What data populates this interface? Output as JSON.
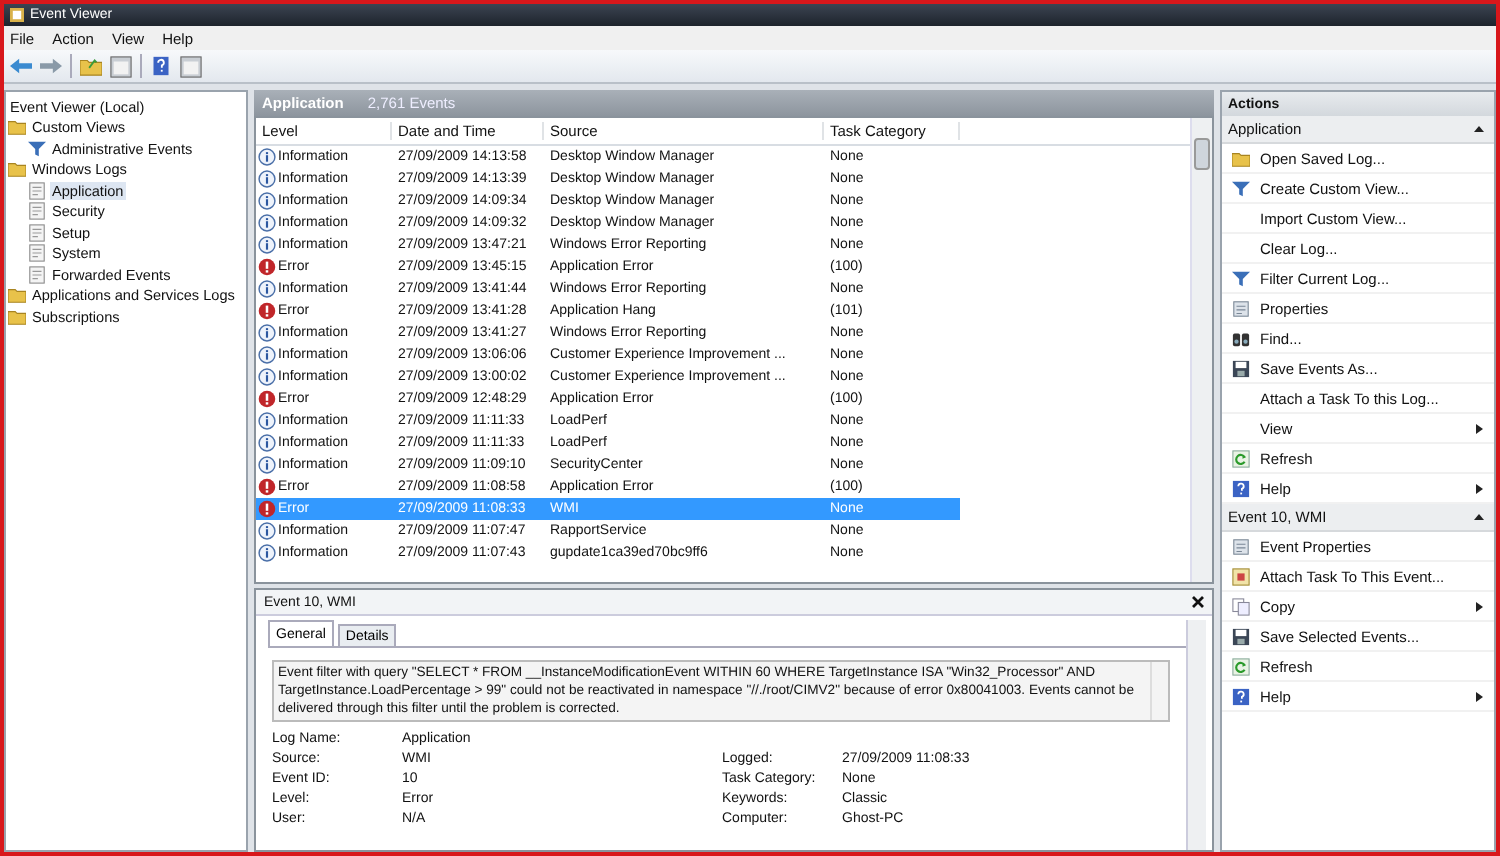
{
  "window": {
    "title": "Event Viewer"
  },
  "menu": [
    "File",
    "Action",
    "View",
    "Help"
  ],
  "toolbar": [
    {
      "kind": "back"
    },
    {
      "kind": "forward"
    },
    {
      "kind": "folder"
    },
    {
      "kind": "pane"
    },
    {
      "kind": "help"
    },
    {
      "kind": "pane"
    }
  ],
  "tree": {
    "label": "Event Viewer (Local)",
    "children": [
      {
        "label": "Custom Views",
        "kind": "folder",
        "selected": false,
        "children": [
          {
            "label": "Administrative Events",
            "kind": "filter",
            "selected": false
          }
        ]
      },
      {
        "label": "Windows Logs",
        "kind": "folder",
        "selected": false,
        "children": [
          {
            "label": "Application",
            "kind": "log",
            "selected": true
          },
          {
            "label": "Security",
            "kind": "log",
            "selected": false
          },
          {
            "label": "Setup",
            "kind": "log",
            "selected": false
          },
          {
            "label": "System",
            "kind": "log",
            "selected": false
          },
          {
            "label": "Forwarded Events",
            "kind": "log",
            "selected": false
          }
        ]
      },
      {
        "label": "Applications and Services Logs",
        "kind": "folder",
        "selected": false
      },
      {
        "label": "Subscriptions",
        "kind": "folder",
        "selected": false
      }
    ]
  },
  "log_header": {
    "name": "Application",
    "count": "2,761 Events"
  },
  "table": {
    "columns": [
      "Level",
      "Date and Time",
      "Source",
      "Task Category"
    ],
    "rows": [
      {
        "kind": "information",
        "level": "Information",
        "date": "27/09/2009 14:13:58",
        "source": "Desktop Window Manager",
        "category": "None",
        "selected": false
      },
      {
        "kind": "information",
        "level": "Information",
        "date": "27/09/2009 14:13:39",
        "source": "Desktop Window Manager",
        "category": "None",
        "selected": false
      },
      {
        "kind": "information",
        "level": "Information",
        "date": "27/09/2009 14:09:34",
        "source": "Desktop Window Manager",
        "category": "None",
        "selected": false
      },
      {
        "kind": "information",
        "level": "Information",
        "date": "27/09/2009 14:09:32",
        "source": "Desktop Window Manager",
        "category": "None",
        "selected": false
      },
      {
        "kind": "information",
        "level": "Information",
        "date": "27/09/2009 13:47:21",
        "source": "Windows Error Reporting",
        "category": "None",
        "selected": false
      },
      {
        "kind": "error",
        "level": "Error",
        "date": "27/09/2009 13:45:15",
        "source": "Application Error",
        "category": "(100)",
        "selected": false
      },
      {
        "kind": "information",
        "level": "Information",
        "date": "27/09/2009 13:41:44",
        "source": "Windows Error Reporting",
        "category": "None",
        "selected": false
      },
      {
        "kind": "error",
        "level": "Error",
        "date": "27/09/2009 13:41:28",
        "source": "Application Hang",
        "category": "(101)",
        "selected": false
      },
      {
        "kind": "information",
        "level": "Information",
        "date": "27/09/2009 13:41:27",
        "source": "Windows Error Reporting",
        "category": "None",
        "selected": false
      },
      {
        "kind": "information",
        "level": "Information",
        "date": "27/09/2009 13:06:06",
        "source": "Customer Experience Improvement ...",
        "category": "None",
        "selected": false
      },
      {
        "kind": "information",
        "level": "Information",
        "date": "27/09/2009 13:00:02",
        "source": "Customer Experience Improvement ...",
        "category": "None",
        "selected": false
      },
      {
        "kind": "error",
        "level": "Error",
        "date": "27/09/2009 12:48:29",
        "source": "Application Error",
        "category": "(100)",
        "selected": false
      },
      {
        "kind": "information",
        "level": "Information",
        "date": "27/09/2009 11:11:33",
        "source": "LoadPerf",
        "category": "None",
        "selected": false
      },
      {
        "kind": "information",
        "level": "Information",
        "date": "27/09/2009 11:11:33",
        "source": "LoadPerf",
        "category": "None",
        "selected": false
      },
      {
        "kind": "information",
        "level": "Information",
        "date": "27/09/2009 11:09:10",
        "source": "SecurityCenter",
        "category": "None",
        "selected": false
      },
      {
        "kind": "error",
        "level": "Error",
        "date": "27/09/2009 11:08:58",
        "source": "Application Error",
        "category": "(100)",
        "selected": false
      },
      {
        "kind": "error",
        "level": "Error",
        "date": "27/09/2009 11:08:33",
        "source": "WMI",
        "category": "None",
        "selected": true
      },
      {
        "kind": "information",
        "level": "Information",
        "date": "27/09/2009 11:07:47",
        "source": "RapportService",
        "category": "None",
        "selected": false
      },
      {
        "kind": "information",
        "level": "Information",
        "date": "27/09/2009 11:07:43",
        "source": "gupdate1ca39ed70bc9ff6",
        "category": "None",
        "selected": false
      }
    ]
  },
  "detail": {
    "title": "Event 10, WMI",
    "tabs": [
      {
        "label": "General",
        "selected": true
      },
      {
        "label": "Details",
        "selected": false
      }
    ],
    "description": "Event filter with query \"SELECT * FROM __InstanceModificationEvent WITHIN 60 WHERE TargetInstance ISA \"Win32_Processor\" AND TargetInstance.LoadPercentage > 99\" could not be reactivated in namespace \"//./root/CIMV2\" because of error 0x80041003. Events cannot be delivered through this filter until the problem is corrected.",
    "fields": [
      {
        "left": {
          "label": "Log Name:",
          "value": "Application"
        }
      },
      {
        "left": {
          "label": "Source:",
          "value": "WMI"
        },
        "right": {
          "label": "Logged:",
          "value": "27/09/2009 11:08:33"
        }
      },
      {
        "left": {
          "label": "Event ID:",
          "value": "10"
        },
        "right": {
          "label": "Task Category:",
          "value": "None"
        }
      },
      {
        "left": {
          "label": "Level:",
          "value": "Error"
        },
        "right": {
          "label": "Keywords:",
          "value": "Classic"
        }
      },
      {
        "left": {
          "label": "User:",
          "value": "N/A"
        },
        "right": {
          "label": "Computer:",
          "value": "Ghost-PC"
        }
      }
    ]
  },
  "actions": {
    "title": "Actions",
    "groups": [
      {
        "title": "Application",
        "items": [
          {
            "label": "Open Saved Log...",
            "kind": "folder",
            "submenu": false
          },
          {
            "label": "Create Custom View...",
            "kind": "filter",
            "submenu": false
          },
          {
            "label": "Import Custom View...",
            "kind": "none",
            "submenu": false
          },
          {
            "label": "Clear Log...",
            "kind": "none",
            "submenu": false
          },
          {
            "label": "Filter Current Log...",
            "kind": "filter",
            "submenu": false
          },
          {
            "label": "Properties",
            "kind": "sheet",
            "submenu": false
          },
          {
            "label": "Find...",
            "kind": "binoculars",
            "submenu": false
          },
          {
            "label": "Save Events As...",
            "kind": "disk",
            "submenu": false
          },
          {
            "label": "Attach a Task To this Log...",
            "kind": "none",
            "submenu": false
          },
          {
            "label": "View",
            "kind": "none",
            "submenu": true
          },
          {
            "label": "Refresh",
            "kind": "refresh",
            "submenu": false
          },
          {
            "label": "Help",
            "kind": "help",
            "submenu": true
          }
        ]
      },
      {
        "title": "Event 10, WMI",
        "items": [
          {
            "label": "Event Properties",
            "kind": "sheet",
            "submenu": false
          },
          {
            "label": "Attach Task To This Event...",
            "kind": "task",
            "submenu": false
          },
          {
            "label": "Copy",
            "kind": "copy",
            "submenu": true
          },
          {
            "label": "Save Selected Events...",
            "kind": "disk",
            "submenu": false
          },
          {
            "label": "Refresh",
            "kind": "refresh",
            "submenu": false
          },
          {
            "label": "Help",
            "kind": "help",
            "submenu": true
          }
        ]
      }
    ]
  }
}
